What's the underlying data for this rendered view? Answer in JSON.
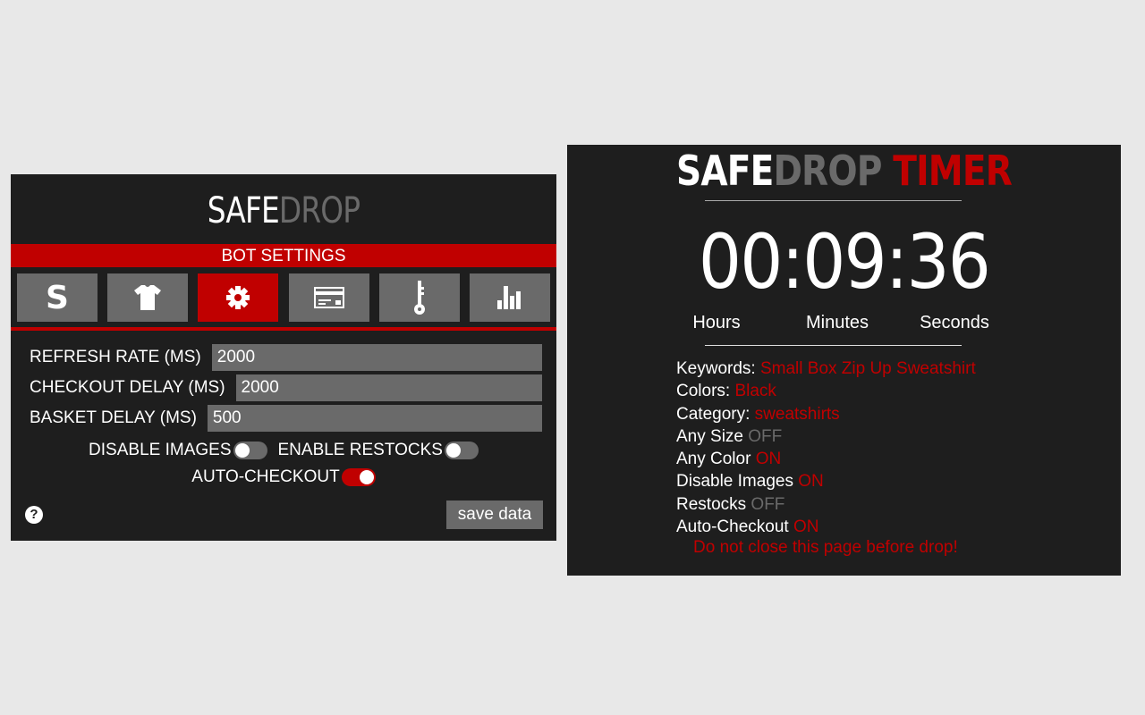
{
  "settings_panel": {
    "logo": {
      "part1": "SAFE",
      "part2": "DROP"
    },
    "banner": "BOT SETTINGS",
    "tabs": [
      {
        "icon": "supreme-s-icon",
        "glyph": "S",
        "active": false
      },
      {
        "icon": "tshirt-icon",
        "active": false
      },
      {
        "icon": "gear-icon",
        "active": true
      },
      {
        "icon": "credit-card-icon",
        "active": false
      },
      {
        "icon": "key-icon",
        "active": false
      },
      {
        "icon": "bar-chart-icon",
        "active": false
      }
    ],
    "fields": [
      {
        "label": "REFRESH RATE (MS)",
        "value": "2000"
      },
      {
        "label": "CHECKOUT DELAY (MS)",
        "value": "2000"
      },
      {
        "label": "BASKET DELAY (MS)",
        "value": "500"
      }
    ],
    "toggles": [
      {
        "label": "DISABLE IMAGES",
        "on": false
      },
      {
        "label": "ENABLE RESTOCKS",
        "on": false
      },
      {
        "label": "AUTO-CHECKOUT",
        "on": true
      }
    ],
    "help_label": "?",
    "save_label": "save data"
  },
  "timer_panel": {
    "logo": {
      "part1": "SAFE",
      "part2": "DROP",
      "part3": " TIMER"
    },
    "time": "00:09:36",
    "units": {
      "hours": "Hours",
      "minutes": "Minutes",
      "seconds": "Seconds"
    },
    "info": [
      {
        "label": "Keywords: ",
        "value": "Small Box Zip Up Sweatshirt",
        "state": "red"
      },
      {
        "label": "Colors: ",
        "value": "Black",
        "state": "red"
      },
      {
        "label": "Category: ",
        "value": "sweatshirts",
        "state": "red"
      },
      {
        "label": "Any Size ",
        "value": "OFF",
        "state": "grey"
      },
      {
        "label": "Any Color ",
        "value": "ON",
        "state": "red"
      },
      {
        "label": "Disable Images ",
        "value": "ON",
        "state": "red"
      },
      {
        "label": "Restocks ",
        "value": "OFF",
        "state": "grey"
      },
      {
        "label": "Auto-Checkout ",
        "value": "ON",
        "state": "red"
      }
    ],
    "warning": "Do not close this page before drop!"
  },
  "colors": {
    "accent": "#c00000",
    "panel_bg": "#1e1e1e",
    "muted": "#6a6a6a",
    "page_bg": "#e8e8e8"
  }
}
